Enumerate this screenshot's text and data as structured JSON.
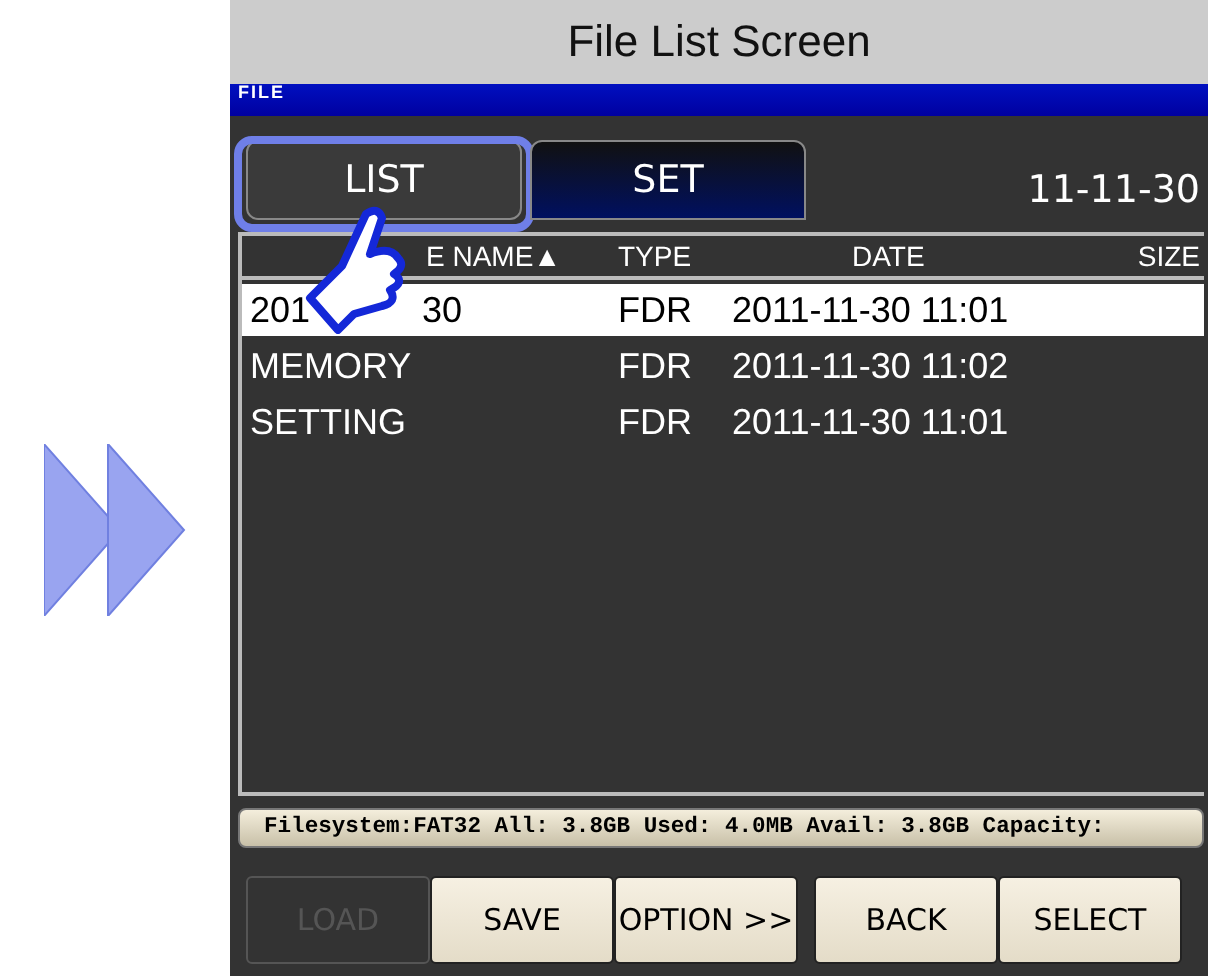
{
  "caption": "File List Screen",
  "screen": {
    "header": "FILE",
    "tabs": [
      {
        "label": "LIST",
        "selected": true
      },
      {
        "label": "SET",
        "selected": false
      }
    ],
    "date": "11-11-30",
    "columns": [
      "E NAME▲",
      "TYPE",
      "DATE",
      "SIZE"
    ],
    "rows": [
      {
        "name_parts": [
          "201",
          "30"
        ],
        "type": "FDR",
        "date": "2011-11-30 11:01",
        "selected": true
      },
      {
        "name_parts": [
          "MEMORY"
        ],
        "type": "FDR",
        "date": "2011-11-30 11:02",
        "selected": false
      },
      {
        "name_parts": [
          "SETTING"
        ],
        "type": "FDR",
        "date": "2011-11-30 11:01",
        "selected": false
      }
    ],
    "status": "Filesystem:FAT32 All: 3.8GB Used: 4.0MB Avail: 3.8GB Capacity:",
    "left_buttons": [
      {
        "label": "LOAD",
        "disabled": true
      },
      {
        "label": "SAVE",
        "disabled": false
      },
      {
        "label": "OPTION >>",
        "disabled": false
      }
    ],
    "right_buttons": [
      {
        "label": "BACK",
        "disabled": false
      },
      {
        "label": "SELECT",
        "disabled": false
      }
    ]
  }
}
